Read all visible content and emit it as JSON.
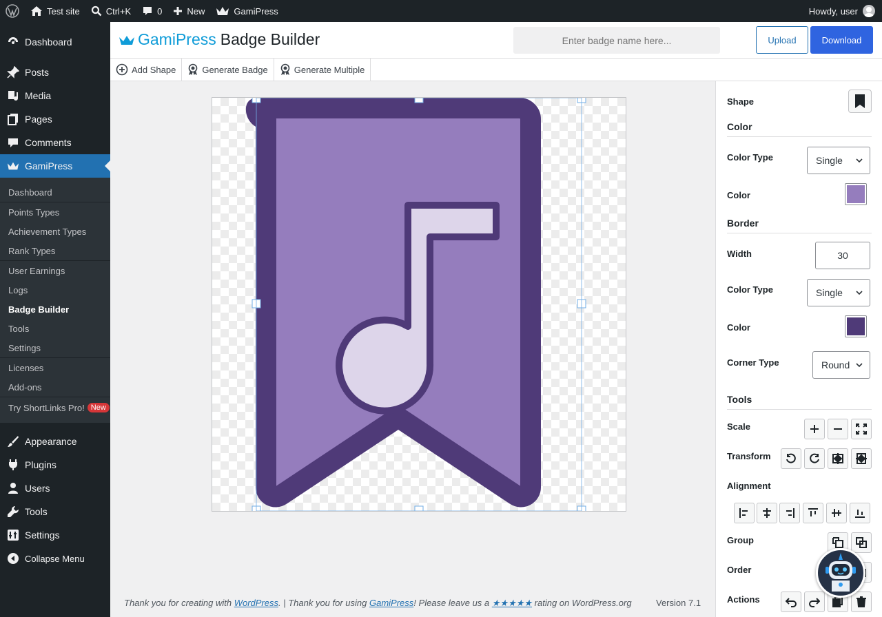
{
  "adminbar": {
    "site_name": "Test site",
    "search_shortcut": "Ctrl+K",
    "comments_count": "0",
    "new_label": "New",
    "plugin_label": "GamiPress",
    "howdy": "Howdy, user"
  },
  "sidebar": {
    "items_top": [
      {
        "label": "Dashboard",
        "icon": "dashboard-icon"
      },
      {
        "label": "Posts",
        "icon": "pin-icon"
      },
      {
        "label": "Media",
        "icon": "media-icon"
      },
      {
        "label": "Pages",
        "icon": "pages-icon"
      },
      {
        "label": "Comments",
        "icon": "comment-icon"
      },
      {
        "label": "GamiPress",
        "icon": "crown-icon"
      }
    ],
    "submenu": [
      {
        "label": "Dashboard"
      },
      {
        "label": "Points Types"
      },
      {
        "label": "Achievement Types"
      },
      {
        "label": "Rank Types"
      },
      {
        "label": "User Earnings"
      },
      {
        "label": "Logs"
      },
      {
        "label": "Badge Builder"
      },
      {
        "label": "Tools"
      },
      {
        "label": "Settings"
      },
      {
        "label": "Licenses"
      },
      {
        "label": "Add-ons"
      },
      {
        "label": "Try ShortLinks Pro!"
      }
    ],
    "new_badge": "New",
    "items_bottom": [
      {
        "label": "Appearance",
        "icon": "brush-icon"
      },
      {
        "label": "Plugins",
        "icon": "plug-icon"
      },
      {
        "label": "Users",
        "icon": "user-icon"
      },
      {
        "label": "Tools",
        "icon": "wrench-icon"
      },
      {
        "label": "Settings",
        "icon": "settings-icon"
      },
      {
        "label": "Collapse Menu",
        "icon": "collapse-icon"
      }
    ]
  },
  "header": {
    "brand": "GamiPress",
    "title": "Badge Builder",
    "badge_name_placeholder": "Enter badge name here...",
    "upload_label": "Upload",
    "download_label": "Download"
  },
  "toolbar": {
    "add_shape": "Add Shape",
    "generate_badge": "Generate Badge",
    "generate_multiple": "Generate Multiple"
  },
  "badge": {
    "fill_color": "#957dbd",
    "border_color": "#4f3a78",
    "note_fill_color": "#ddd5ea"
  },
  "panel": {
    "shape_label": "Shape",
    "shape_icon": "bookmark-icon",
    "color_section": "Color",
    "color_type_label": "Color Type",
    "color_type_value": "Single",
    "color_label": "Color",
    "color_value": "#957dbd",
    "border_section": "Border",
    "width_label": "Width",
    "width_value": "30",
    "border_color_type_label": "Color Type",
    "border_color_type_value": "Single",
    "border_color_label": "Color",
    "border_color_value": "#4f3a78",
    "corner_type_label": "Corner Type",
    "corner_type_value": "Round",
    "tools_section": "Tools",
    "scale_label": "Scale",
    "transform_label": "Transform",
    "alignment_label": "Alignment",
    "group_label": "Group",
    "order_label": "Order",
    "actions_label": "Actions"
  },
  "footer": {
    "text1": "Thank you for creating with ",
    "wp_link": "WordPress",
    "text2": ". | Thank you for using ",
    "gp_link": "GamiPress",
    "text3": "! Please leave us a ",
    "stars": "★★★★★",
    "text4": " rating on WordPress.org",
    "version": "Version 7.1"
  }
}
